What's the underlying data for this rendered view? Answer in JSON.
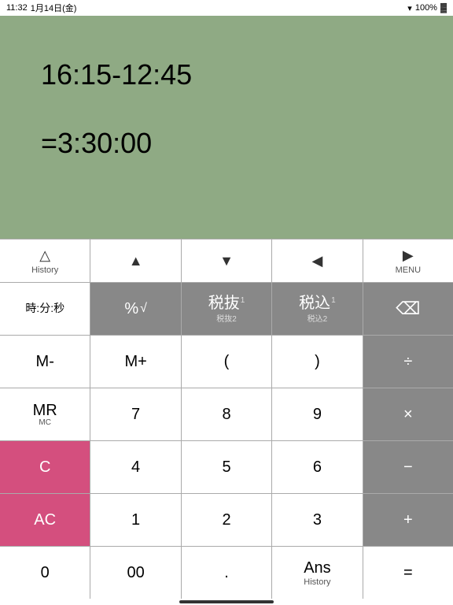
{
  "statusBar": {
    "time": "11:32",
    "date": "1月14日(金)",
    "wifi": "WiFi",
    "battery": "100%"
  },
  "display": {
    "line1": "16:15-12:45",
    "line2": "=3:30:00"
  },
  "navRow": {
    "btn1": {
      "icon": "△",
      "label": "History"
    },
    "btn2": {
      "icon": "▲",
      "label": ""
    },
    "btn3": {
      "icon": "▼",
      "label": ""
    },
    "btn4": {
      "icon": "◀",
      "label": ""
    },
    "btn5": {
      "icon": "▶",
      "label": "MENU"
    }
  },
  "rows": [
    {
      "id": "row1",
      "buttons": [
        {
          "id": "btn-time",
          "main": "時:分:秒",
          "sub": "",
          "style": "white",
          "mainSize": 14
        },
        {
          "id": "btn-percent",
          "main": "%",
          "sub": "√",
          "style": "gray",
          "subRight": true
        },
        {
          "id": "btn-tax-ex",
          "main": "税抜",
          "sub1": "1",
          "sub2": "税抜2",
          "style": "gray"
        },
        {
          "id": "btn-tax-in",
          "main": "税込",
          "sub1": "1",
          "sub2": "税込2",
          "style": "gray"
        },
        {
          "id": "btn-back",
          "main": "⌫",
          "sub": "",
          "style": "gray"
        }
      ]
    },
    {
      "id": "row2",
      "buttons": [
        {
          "id": "btn-mminus",
          "main": "M-",
          "sub": "",
          "style": "white"
        },
        {
          "id": "btn-mplus",
          "main": "M+",
          "sub": "",
          "style": "white"
        },
        {
          "id": "btn-lparen",
          "main": "(",
          "sub": "",
          "style": "white"
        },
        {
          "id": "btn-rparen",
          "main": ")",
          "sub": "",
          "style": "white"
        },
        {
          "id": "btn-divide",
          "main": "÷",
          "sub": "",
          "style": "gray"
        }
      ]
    },
    {
      "id": "row3",
      "buttons": [
        {
          "id": "btn-mr",
          "main": "MR",
          "sub": "MC",
          "style": "white"
        },
        {
          "id": "btn-7",
          "main": "7",
          "sub": "",
          "style": "white"
        },
        {
          "id": "btn-8",
          "main": "8",
          "sub": "",
          "style": "white"
        },
        {
          "id": "btn-9",
          "main": "9",
          "sub": "",
          "style": "white"
        },
        {
          "id": "btn-multiply",
          "main": "×",
          "sub": "",
          "style": "gray"
        }
      ]
    },
    {
      "id": "row4",
      "buttons": [
        {
          "id": "btn-c",
          "main": "C",
          "sub": "",
          "style": "pink"
        },
        {
          "id": "btn-4",
          "main": "4",
          "sub": "",
          "style": "white"
        },
        {
          "id": "btn-5",
          "main": "5",
          "sub": "",
          "style": "white"
        },
        {
          "id": "btn-6",
          "main": "6",
          "sub": "",
          "style": "white"
        },
        {
          "id": "btn-minus",
          "main": "−",
          "sub": "",
          "style": "gray"
        }
      ]
    },
    {
      "id": "row5",
      "buttons": [
        {
          "id": "btn-ac",
          "main": "AC",
          "sub": "",
          "style": "pink"
        },
        {
          "id": "btn-1",
          "main": "1",
          "sub": "",
          "style": "white"
        },
        {
          "id": "btn-2",
          "main": "2",
          "sub": "",
          "style": "white"
        },
        {
          "id": "btn-3",
          "main": "3",
          "sub": "",
          "style": "white"
        },
        {
          "id": "btn-plus",
          "main": "+",
          "sub": "",
          "style": "gray"
        }
      ]
    },
    {
      "id": "row6",
      "buttons": [
        {
          "id": "btn-0",
          "main": "0",
          "sub": "",
          "style": "white"
        },
        {
          "id": "btn-00",
          "main": "00",
          "sub": "",
          "style": "white"
        },
        {
          "id": "btn-dot",
          "main": ".",
          "sub": "",
          "style": "white"
        },
        {
          "id": "btn-ans",
          "main": "Ans",
          "sub": "History",
          "style": "white",
          "isAns": true
        },
        {
          "id": "btn-equals",
          "main": "=",
          "sub": "",
          "style": "white"
        }
      ]
    }
  ]
}
